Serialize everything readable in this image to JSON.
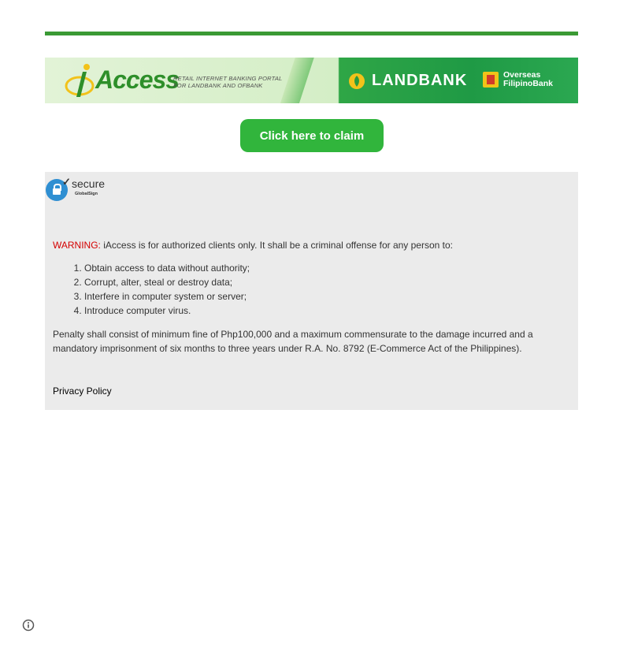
{
  "banner": {
    "logo_text": "Access",
    "tagline_line1": "RETAIL INTERNET BANKING PORTAL",
    "tagline_line2": "FOR LANDBANK AND OFBANK",
    "landbank_text": "LANDBANK",
    "ofbank_line1": "Overseas",
    "ofbank_line2": "FilipinoBank"
  },
  "claim_button": {
    "label": "Click here to claim"
  },
  "secure_badge": {
    "word": "secure",
    "sub": "GlobalSign"
  },
  "warning": {
    "label": "WARNING:",
    "text": " iAccess is for authorized clients only. It shall be a criminal offense for any person to:"
  },
  "offenses": [
    "Obtain access to data without authority;",
    "Corrupt, alter, steal or destroy data;",
    "Interfere in computer system or server;",
    "Introduce computer virus."
  ],
  "penalty": "Penalty shall consist of minimum fine of Php100,000 and a maximum commensurate to the damage incurred and a mandatory imprisonment of six months to three years under R.A. No. 8792 (E-Commerce Act of the Philippines).",
  "privacy_link": "Privacy Policy",
  "colors": {
    "accent_green": "#31b53c",
    "top_bar": "#3a9a34",
    "warning_red": "#d40000",
    "panel_bg": "#ebebeb"
  },
  "icons": [
    "iaccess-logo-icon",
    "landbank-logo-icon",
    "ofbank-logo-icon",
    "secure-lock-icon",
    "info-icon"
  ]
}
